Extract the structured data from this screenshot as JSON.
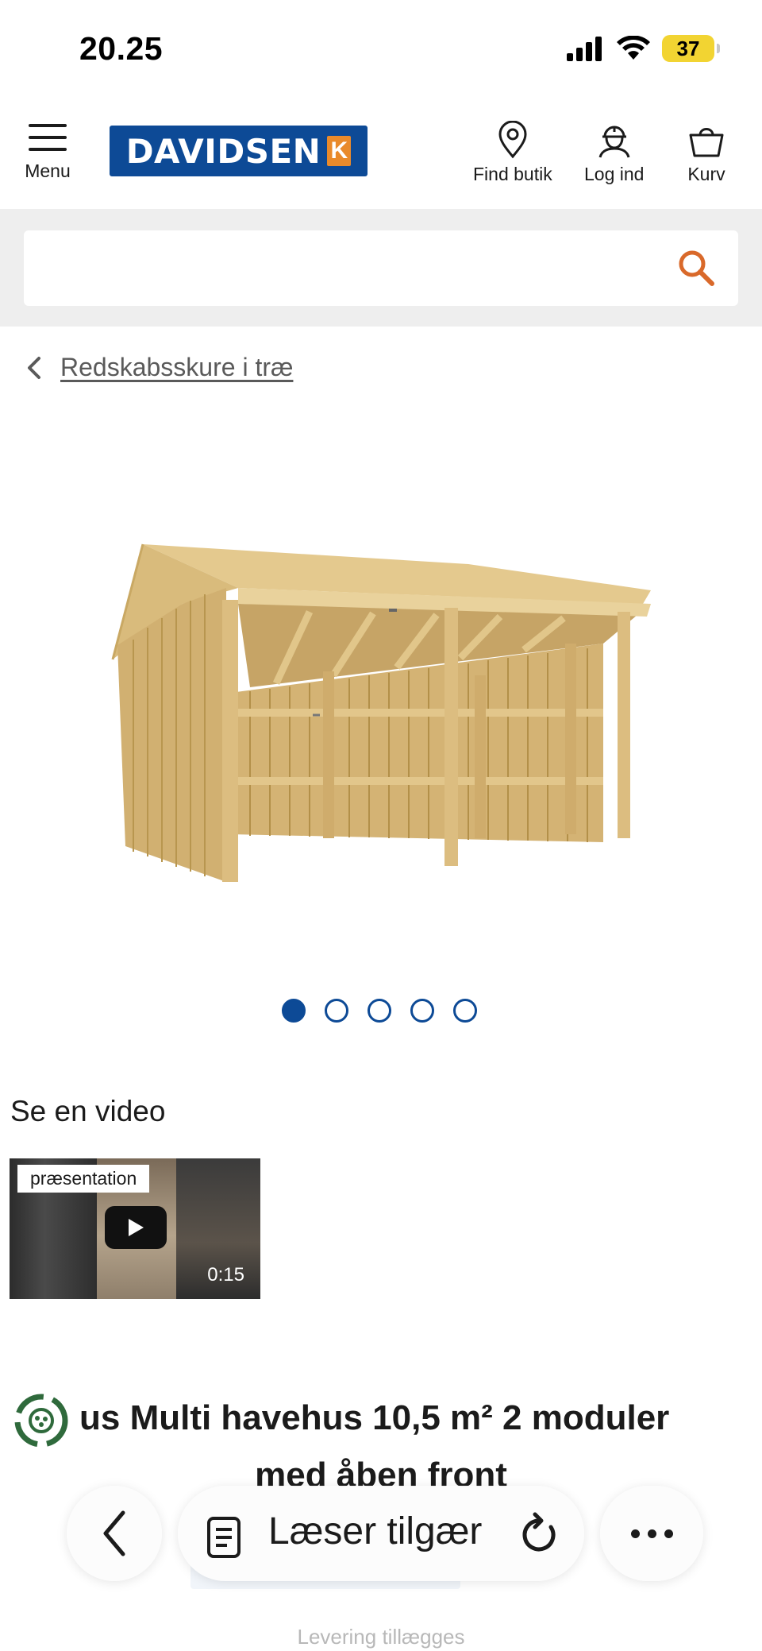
{
  "status_bar": {
    "time": "20.25",
    "battery": "37"
  },
  "header": {
    "menu_label": "Menu",
    "logo_text": "DAVIDSEN",
    "logo_mark": "K",
    "find_store_label": "Find butik",
    "login_label": "Log ind",
    "cart_label": "Kurv"
  },
  "search": {
    "placeholder": "",
    "value": ""
  },
  "breadcrumb": {
    "link": "Redskabsskure i træ"
  },
  "carousel": {
    "slides": 5,
    "active_index": 0
  },
  "video": {
    "heading": "Se en video",
    "tag": "præsentation",
    "duration": "0:15"
  },
  "product": {
    "title_line1": "us Multi havehus 10,5 m² 2 moduler",
    "title_line2": "med åben front",
    "delivery": "Levering tillægges"
  },
  "browser": {
    "address_text": "Læser tilgær",
    "icons": [
      "back-icon",
      "reader-icon",
      "reload-icon",
      "more-icon"
    ]
  },
  "colors": {
    "brand_blue": "#0d4a96",
    "brand_orange": "#e98a2b",
    "search_icon": "#d9692a",
    "battery": "#f2d432",
    "badge_green": "#2f6a3c"
  }
}
